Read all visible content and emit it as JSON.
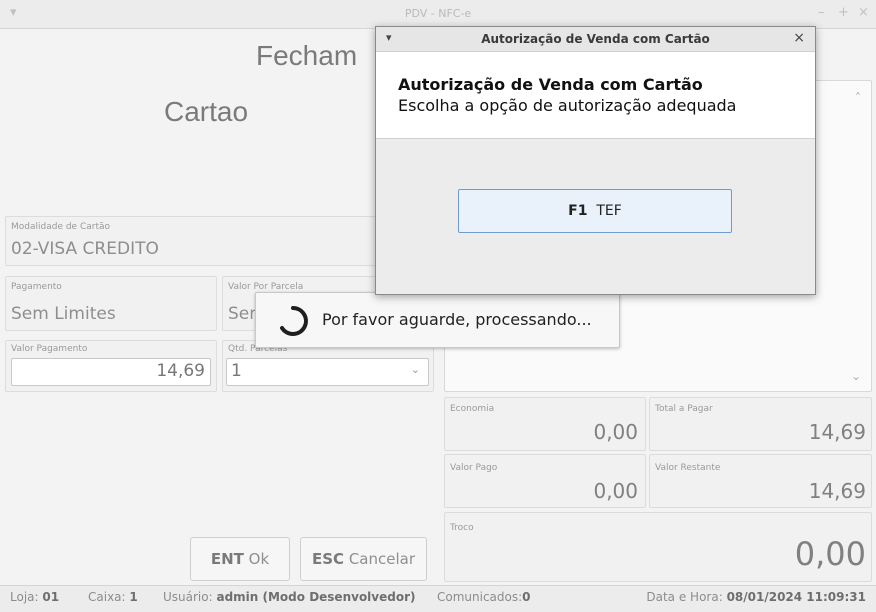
{
  "main_window": {
    "title": "PDV - NFC-e",
    "heading": "Fecham",
    "payment_method": "Cartao",
    "card_mode": {
      "label": "Modalidade de Cartão",
      "value": "02-VISA CREDITO"
    },
    "payment": {
      "label": "Pagamento",
      "value": "Sem Limites"
    },
    "value_field": {
      "label": "Valor Por Parcela",
      "value": "Sem"
    },
    "payment_value": {
      "label": "Valor Pagamento",
      "value": "14,69"
    },
    "installments": {
      "label": "Qtd. Parcelas",
      "value": "1"
    },
    "totals": {
      "economia": {
        "label": "Economia",
        "value": "0,00"
      },
      "total_pagar": {
        "label": "Total a Pagar",
        "value": "14,69"
      },
      "valor_pago": {
        "label": "Valor Pago",
        "value": "0,00"
      },
      "valor_restante": {
        "label": "Valor Restante",
        "value": "14,69"
      },
      "troco": {
        "label": "Troco",
        "value": "0,00"
      }
    },
    "buttons": {
      "ok_key": "ENT",
      "ok_label": "Ok",
      "cancel_key": "ESC",
      "cancel_label": "Cancelar"
    }
  },
  "status_bar": {
    "loja_label": "Loja:",
    "loja": "01",
    "caixa_label": "Caixa:",
    "caixa": "1",
    "usuario_label": "Usuário:",
    "usuario": "admin (Modo Desenvolvedor)",
    "comunicados_label": "Comunicados:",
    "comunicados": "0",
    "datahora_label": "Data e Hora:",
    "datahora": "08/01/2024 11:09:31"
  },
  "busy": {
    "message": "Por favor aguarde, processando..."
  },
  "dialog": {
    "title": "Autorização de Venda com Cartão",
    "heading": "Autorização de Venda com Cartão",
    "subheading": "Escolha a opção de autorização adequada",
    "option_key": "F1",
    "option_label": "TEF"
  },
  "colors": {
    "accent": "#6f9bcf",
    "option_bg": "#e9f1fb"
  },
  "icons": [
    "window-menu-icon",
    "minimize-icon",
    "maximize-icon",
    "close-icon",
    "spinner-icon",
    "chevron-down-icon",
    "chevron-up-icon"
  ]
}
